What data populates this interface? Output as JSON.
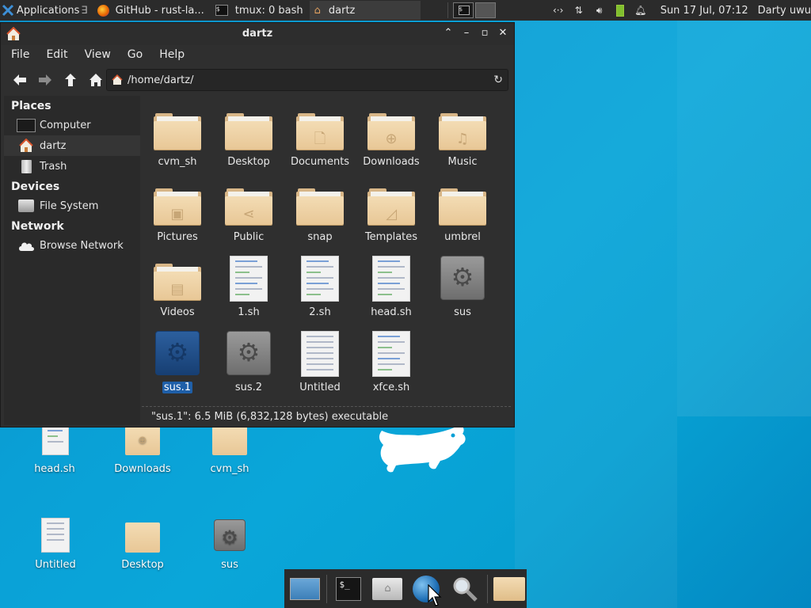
{
  "colors": {
    "panel": "#2b2b2b",
    "window": "#2f2f2f",
    "selection": "#1f5fa8",
    "folder": "#e8c796",
    "desktop": "#0aa0d6"
  },
  "top_panel": {
    "applications_label": "Applications",
    "tasks": [
      {
        "label": "GitHub - rust-la...",
        "icon": "firefox-icon"
      },
      {
        "label": "tmux: 0 bash",
        "icon": "terminal-icon"
      },
      {
        "label": "dartz",
        "icon": "home-folder-icon"
      }
    ],
    "clock": "Sun 17 Jul, 07:12",
    "user": "Darty uwu"
  },
  "window": {
    "title": "dartz",
    "menu": [
      "File",
      "Edit",
      "View",
      "Go",
      "Help"
    ],
    "location": "/home/dartz/",
    "sidebar": {
      "places_header": "Places",
      "places": [
        "Computer",
        "dartz",
        "Trash"
      ],
      "devices_header": "Devices",
      "devices": [
        "File System"
      ],
      "network_header": "Network",
      "network": [
        "Browse Network"
      ]
    },
    "files": [
      {
        "name": "cvm_sh",
        "type": "folder",
        "emblem": ""
      },
      {
        "name": "Desktop",
        "type": "folder",
        "emblem": ""
      },
      {
        "name": "Documents",
        "type": "folder",
        "emblem": "document"
      },
      {
        "name": "Downloads",
        "type": "folder",
        "emblem": "download"
      },
      {
        "name": "Music",
        "type": "folder",
        "emblem": "music"
      },
      {
        "name": "Pictures",
        "type": "folder",
        "emblem": "picture"
      },
      {
        "name": "Public",
        "type": "folder",
        "emblem": "share"
      },
      {
        "name": "snap",
        "type": "folder",
        "emblem": ""
      },
      {
        "name": "Templates",
        "type": "folder",
        "emblem": "template"
      },
      {
        "name": "umbrel",
        "type": "folder",
        "emblem": ""
      },
      {
        "name": "Videos",
        "type": "folder",
        "emblem": "video"
      },
      {
        "name": "1.sh",
        "type": "script",
        "emblem": ""
      },
      {
        "name": "2.sh",
        "type": "script",
        "emblem": ""
      },
      {
        "name": "head.sh",
        "type": "script",
        "emblem": ""
      },
      {
        "name": "sus",
        "type": "executable",
        "emblem": ""
      },
      {
        "name": "sus.1",
        "type": "executable",
        "emblem": "",
        "selected": true
      },
      {
        "name": "sus.2",
        "type": "executable",
        "emblem": ""
      },
      {
        "name": "Untitled",
        "type": "text",
        "emblem": ""
      },
      {
        "name": "xfce.sh",
        "type": "script",
        "emblem": ""
      }
    ],
    "status": "\"sus.1\": 6.5 MiB (6,832,128 bytes) executable"
  },
  "desktop_icons": [
    {
      "name": "head.sh",
      "type": "script"
    },
    {
      "name": "Downloads",
      "type": "folder"
    },
    {
      "name": "cvm_sh",
      "type": "folder"
    },
    {
      "name": "Untitled",
      "type": "text"
    },
    {
      "name": "Desktop",
      "type": "folder"
    },
    {
      "name": "sus",
      "type": "executable"
    }
  ],
  "dock": [
    "show-desktop-icon",
    "terminal-icon",
    "home-folder-icon",
    "web-browser-icon",
    "search-icon",
    "folder-icon"
  ]
}
